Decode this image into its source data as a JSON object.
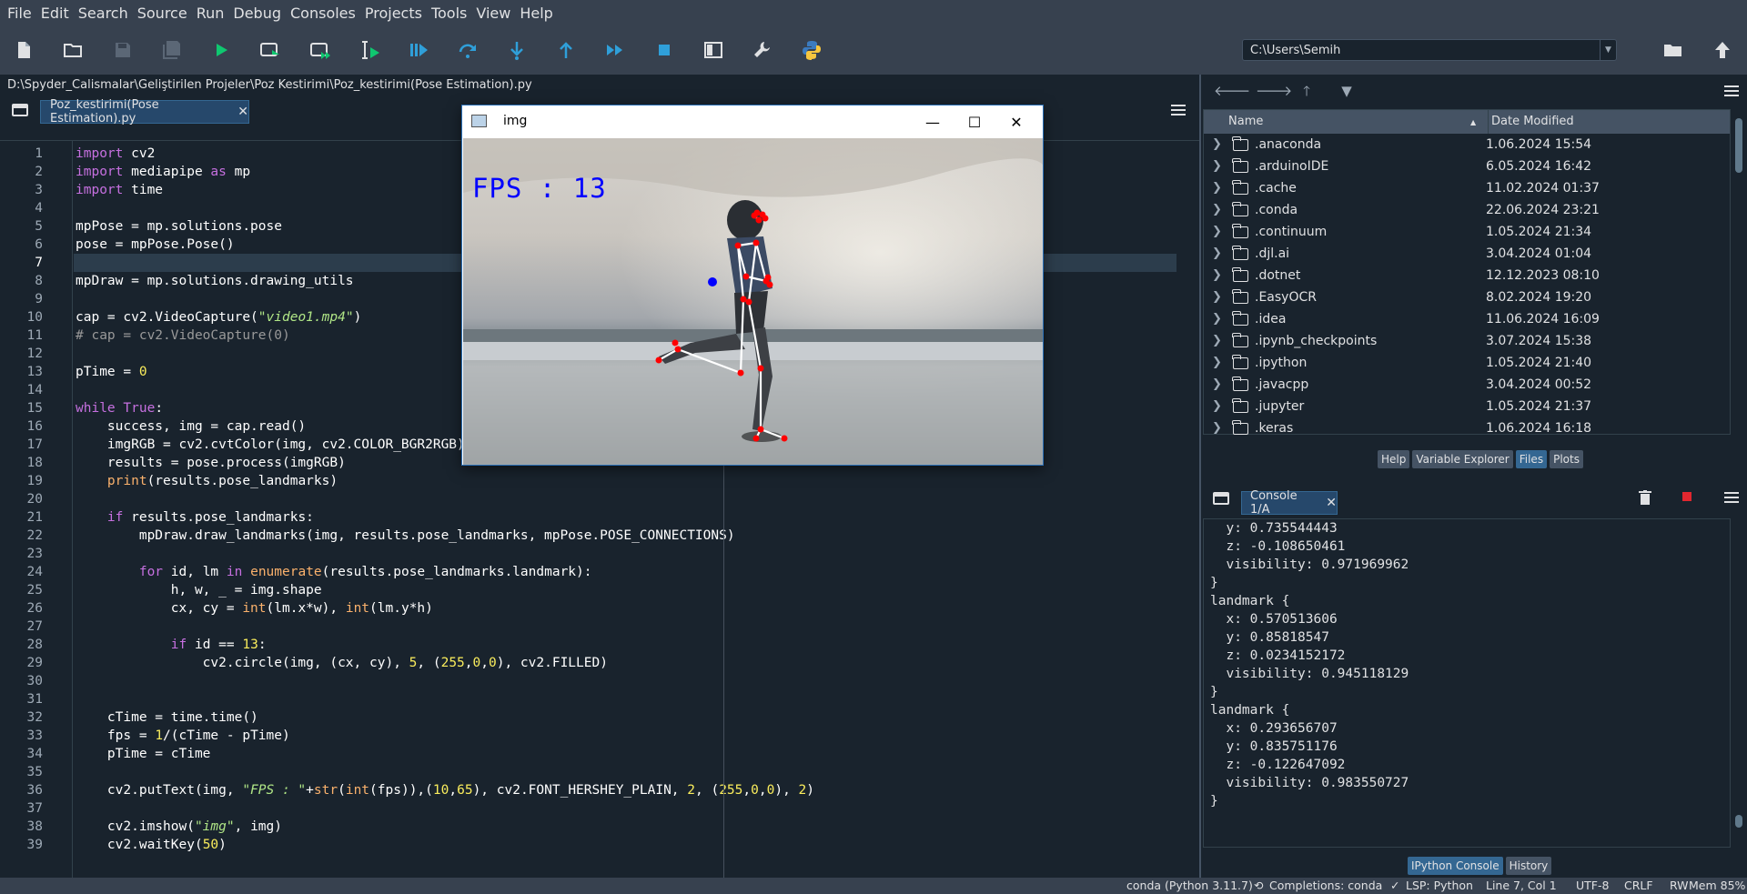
{
  "menu": [
    "File",
    "Edit",
    "Search",
    "Source",
    "Run",
    "Debug",
    "Consoles",
    "Projects",
    "Tools",
    "View",
    "Help"
  ],
  "toolbar": {
    "icons": [
      "new-file-icon",
      "open-folder-icon",
      "save-icon",
      "save-all-icon",
      "run-icon",
      "run-cell-icon",
      "run-cell-advance-icon",
      "run-selection-icon",
      "debug-icon",
      "step-icon",
      "step-into-icon",
      "step-out-icon",
      "continue-icon",
      "stop-icon",
      "maximize-pane-icon",
      "preferences-icon",
      "python-path-icon"
    ],
    "working_dir": "C:\\Users\\Semih"
  },
  "editor": {
    "file_path": "D:\\Spyder_Calismalar\\Geliştirilen Projeler\\Poz Kestirimi\\Poz_kestirimi(Pose Estimation).py",
    "tab_label": "Poz_kestirimi(Pose Estimation).py",
    "current_line": 7,
    "line_numbers": [
      "1",
      "2",
      "3",
      "4",
      "5",
      "6",
      "7",
      "8",
      "9",
      "10",
      "11",
      "12",
      "13",
      "14",
      "15",
      "16",
      "17",
      "18",
      "19",
      "20",
      "21",
      "22",
      "23",
      "24",
      "25",
      "26",
      "27",
      "28",
      "29",
      "30",
      "31",
      "32",
      "33",
      "34",
      "35",
      "36",
      "37",
      "38",
      "39"
    ],
    "lines": [
      [
        [
          "kw",
          "import"
        ],
        [
          "t",
          " cv2"
        ]
      ],
      [
        [
          "kw",
          "import"
        ],
        [
          "t",
          " mediapipe "
        ],
        [
          "kw",
          "as"
        ],
        [
          "t",
          " mp"
        ]
      ],
      [
        [
          "kw",
          "import"
        ],
        [
          "t",
          " time"
        ]
      ],
      [],
      [
        [
          "t",
          "mpPose = mp.solutions.pose"
        ]
      ],
      [
        [
          "t",
          "pose = mpPose.Pose()"
        ]
      ],
      [],
      [
        [
          "t",
          "mpDraw = mp.solutions.drawing_utils"
        ]
      ],
      [],
      [
        [
          "t",
          "cap = cv2.VideoCapture("
        ],
        [
          "str",
          "\"video1.mp4\""
        ],
        [
          "t",
          ")"
        ]
      ],
      [
        [
          "cm",
          "# cap = cv2.VideoCapture(0)"
        ]
      ],
      [],
      [
        [
          "t",
          "pTime = "
        ],
        [
          "num",
          "0"
        ]
      ],
      [],
      [
        [
          "kw",
          "while"
        ],
        [
          "t",
          " "
        ],
        [
          "kw",
          "True"
        ],
        [
          "t",
          ":"
        ]
      ],
      [
        [
          "t",
          "    success, img = cap.read()"
        ]
      ],
      [
        [
          "t",
          "    imgRGB = cv2.cvtColor(img, cv2.COLOR_BGR2RGB)"
        ]
      ],
      [
        [
          "t",
          "    results = pose.process(imgRGB)"
        ]
      ],
      [
        [
          "t",
          "    "
        ],
        [
          "bi",
          "print"
        ],
        [
          "t",
          "(results.pose_landmarks)"
        ]
      ],
      [],
      [
        [
          "t",
          "    "
        ],
        [
          "kw",
          "if"
        ],
        [
          "t",
          " results.pose_landmarks:"
        ]
      ],
      [
        [
          "t",
          "        mpDraw.draw_landmarks(img, results.pose_landmarks, mpPose.POSE_CONNECTIONS)"
        ]
      ],
      [],
      [
        [
          "t",
          "        "
        ],
        [
          "kw",
          "for"
        ],
        [
          "t",
          " id, lm "
        ],
        [
          "kw",
          "in"
        ],
        [
          "t",
          " "
        ],
        [
          "bi",
          "enumerate"
        ],
        [
          "t",
          "(results.pose_landmarks.landmark):"
        ]
      ],
      [
        [
          "t",
          "            h, w, _ = img.shape"
        ]
      ],
      [
        [
          "t",
          "            cx, cy = "
        ],
        [
          "bi",
          "int"
        ],
        [
          "t",
          "(lm.x*w), "
        ],
        [
          "bi",
          "int"
        ],
        [
          "t",
          "(lm.y*h)"
        ]
      ],
      [],
      [
        [
          "t",
          "            "
        ],
        [
          "kw",
          "if"
        ],
        [
          "t",
          " id == "
        ],
        [
          "num",
          "13"
        ],
        [
          "t",
          ":"
        ]
      ],
      [
        [
          "t",
          "                cv2.circle(img, (cx, cy), "
        ],
        [
          "num",
          "5"
        ],
        [
          "t",
          ", ("
        ],
        [
          "num",
          "255"
        ],
        [
          "t",
          ","
        ],
        [
          "num",
          "0"
        ],
        [
          "t",
          ","
        ],
        [
          "num",
          "0"
        ],
        [
          "t",
          "), cv2.FILLED)"
        ]
      ],
      [],
      [],
      [
        [
          "t",
          "    cTime = time.time()"
        ]
      ],
      [
        [
          "t",
          "    fps = "
        ],
        [
          "num",
          "1"
        ],
        [
          "t",
          "/(cTime - pTime)"
        ]
      ],
      [
        [
          "t",
          "    pTime = cTime"
        ]
      ],
      [],
      [
        [
          "t",
          "    cv2.putText(img, "
        ],
        [
          "str",
          "\"FPS : \""
        ],
        [
          "t",
          "+"
        ],
        [
          "bi",
          "str"
        ],
        [
          "t",
          "("
        ],
        [
          "bi",
          "int"
        ],
        [
          "t",
          "(fps)),("
        ],
        [
          "num",
          "10"
        ],
        [
          "t",
          ","
        ],
        [
          "num",
          "65"
        ],
        [
          "t",
          "), cv2.FONT_HERSHEY_PLAIN, "
        ],
        [
          "num",
          "2"
        ],
        [
          "t",
          ", ("
        ],
        [
          "num",
          "255"
        ],
        [
          "t",
          ","
        ],
        [
          "num",
          "0"
        ],
        [
          "t",
          ","
        ],
        [
          "num",
          "0"
        ],
        [
          "t",
          "), "
        ],
        [
          "num",
          "2"
        ],
        [
          "t",
          ")"
        ]
      ],
      [],
      [
        [
          "t",
          "    cv2.imshow("
        ],
        [
          "str",
          "\"img\""
        ],
        [
          "t",
          ", img)"
        ]
      ],
      [
        [
          "t",
          "    cv2.waitKey("
        ],
        [
          "num",
          "50"
        ],
        [
          "t",
          ")"
        ]
      ]
    ]
  },
  "files": {
    "columns": {
      "name": "Name",
      "date": "Date Modified"
    },
    "rows": [
      {
        "name": ".anaconda",
        "date": "1.06.2024 15:54"
      },
      {
        "name": ".arduinoIDE",
        "date": "6.05.2024 16:42"
      },
      {
        "name": ".cache",
        "date": "11.02.2024 01:37"
      },
      {
        "name": ".conda",
        "date": "22.06.2024 23:21"
      },
      {
        "name": ".continuum",
        "date": "1.05.2024 21:34"
      },
      {
        "name": ".djl.ai",
        "date": "3.04.2024 01:04"
      },
      {
        "name": ".dotnet",
        "date": "12.12.2023 08:10"
      },
      {
        "name": ".EasyOCR",
        "date": "8.02.2024 19:20"
      },
      {
        "name": ".idea",
        "date": "11.06.2024 16:09"
      },
      {
        "name": ".ipynb_checkpoints",
        "date": "3.07.2024 15:38"
      },
      {
        "name": ".ipython",
        "date": "1.05.2024 21:40"
      },
      {
        "name": ".javacpp",
        "date": "3.04.2024 00:52"
      },
      {
        "name": ".jupyter",
        "date": "1.05.2024 21:37"
      },
      {
        "name": ".keras",
        "date": "1.06.2024 16:18"
      }
    ],
    "tabs": [
      "Help",
      "Variable Explorer",
      "Files",
      "Plots"
    ],
    "active_tab": "Files"
  },
  "console": {
    "tab_label": "Console 1/A",
    "lines": [
      "  y: 0.735544443",
      "  z: -0.108650461",
      "  visibility: 0.971969962",
      "}",
      "landmark {",
      "  x: 0.570513606",
      "  y: 0.85818547",
      "  z: 0.0234152172",
      "  visibility: 0.945118129",
      "}",
      "landmark {",
      "  x: 0.293656707",
      "  y: 0.835751176",
      "  z: -0.122647092",
      "  visibility: 0.983550727",
      "}"
    ],
    "tabs": [
      "IPython Console",
      "History"
    ],
    "active_tab": "IPython Console"
  },
  "statusbar": {
    "env": "conda (Python 3.11.7)",
    "completions": "Completions: conda",
    "lsp": "LSP: Python",
    "position": "Line 7, Col 1",
    "encoding": "UTF-8",
    "eol": "CRLF",
    "mode": "RW",
    "memory": "Mem 85%"
  },
  "img_window": {
    "title": "img",
    "fps_overlay": "FPS : 13"
  },
  "colors": {
    "background": "#19232d",
    "toolbar": "#37414f",
    "accent": "#346792",
    "keyword": "#c670e0",
    "string": "#b0e686",
    "number": "#faed5c",
    "builtin": "#fab16c"
  }
}
